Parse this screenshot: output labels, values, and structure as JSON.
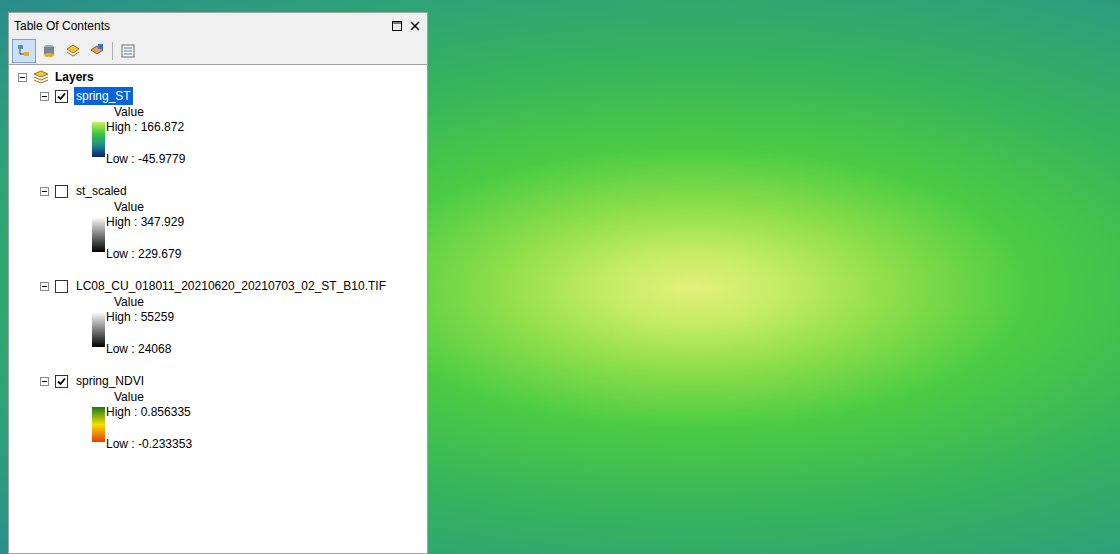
{
  "window": {
    "title": "Table Of Contents"
  },
  "tree": {
    "root": {
      "label": "Layers",
      "expanded": true
    },
    "layers": [
      {
        "name": "spring_ST",
        "checked": true,
        "selected": true,
        "expanded": true,
        "field": "Value",
        "high": "High : 166.872",
        "low": "Low : -45.9779",
        "colors": [
          "#c8f064",
          "#3cc83c",
          "#1e8c8c",
          "#0a1e6e"
        ]
      },
      {
        "name": "st_scaled",
        "checked": false,
        "selected": false,
        "expanded": true,
        "field": "Value",
        "high": "High : 347.929",
        "low": "Low : 229.679",
        "colors": [
          "#ffffff",
          "#000000"
        ]
      },
      {
        "name": "LC08_CU_018011_20210620_20210703_02_ST_B10.TIF",
        "checked": false,
        "selected": false,
        "expanded": true,
        "field": "Value",
        "high": "High : 55259",
        "low": "Low : 24068",
        "colors": [
          "#ffffff",
          "#000000"
        ]
      },
      {
        "name": "spring_NDVI",
        "checked": true,
        "selected": false,
        "expanded": true,
        "field": "Value",
        "high": "High : 0.856335",
        "low": "Low : -0.233353",
        "colors": [
          "#1a7a1a",
          "#f0e000",
          "#e83c00"
        ]
      }
    ]
  }
}
